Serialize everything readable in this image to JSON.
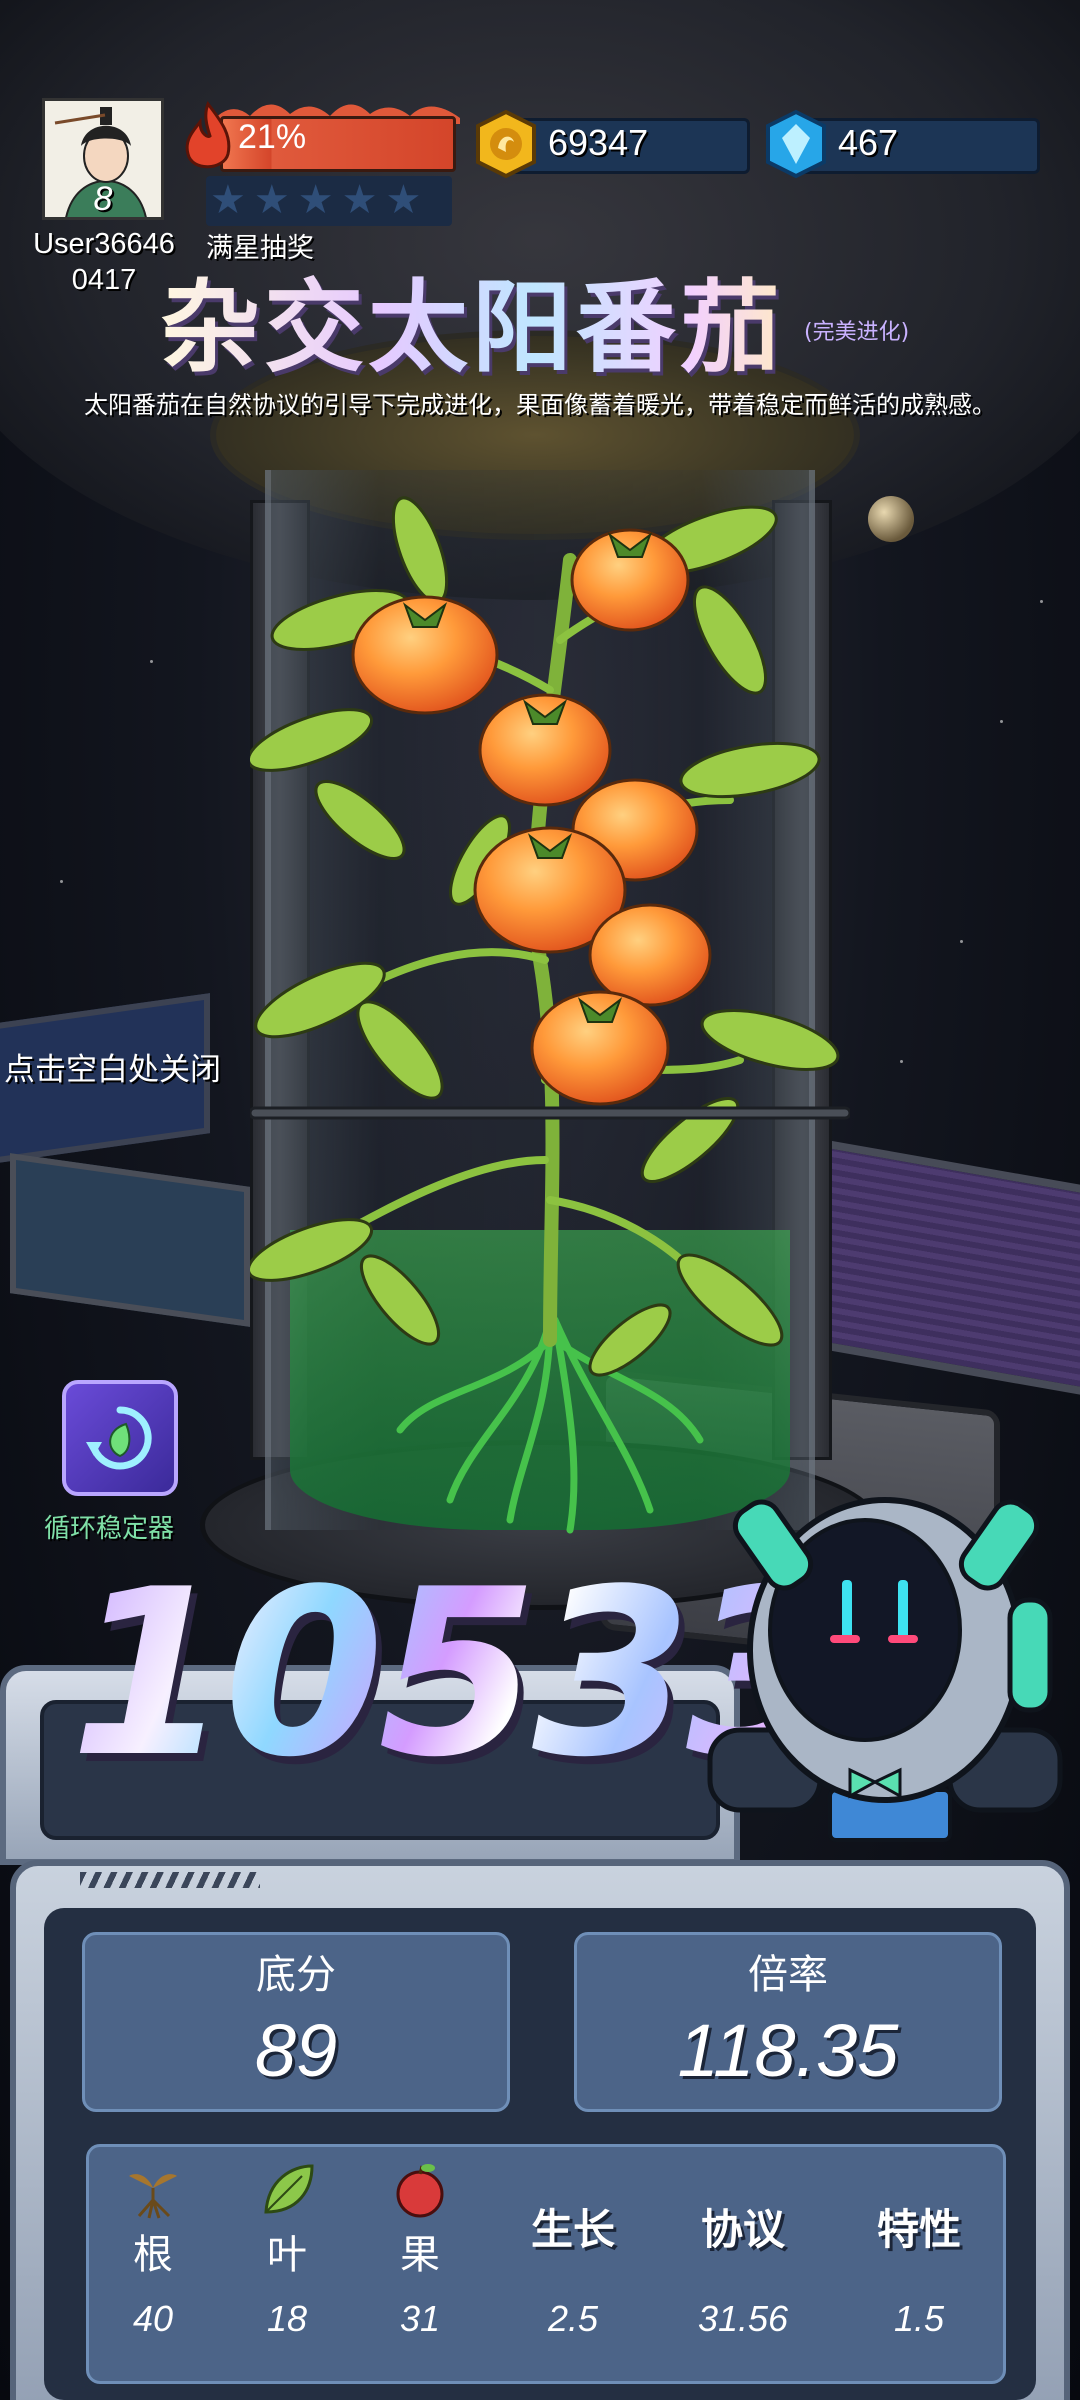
{
  "player": {
    "level": "8",
    "username": "User36646\n0417",
    "heat_percent_label": "21%",
    "heat_progress": 0.21,
    "stars_filled": 0,
    "stars_total": 5,
    "star_reward_label": "满星抽奖",
    "coins": "69347",
    "gems": "467"
  },
  "plant": {
    "name": "杂交太阳番茄",
    "evolution_tag": "(完美进化)",
    "description": "太阳番茄在自然协议的引导下完成进化，果面像蓄着暖光，带着稳定而鲜活的成熟感。"
  },
  "hints": {
    "close": "点击空白处关闭"
  },
  "tool": {
    "name": "循环稳定器",
    "icon": "leaf-cycle-icon"
  },
  "score": {
    "total": "10533",
    "base_label": "底分",
    "base_value": "89",
    "multiplier_label": "倍率",
    "multiplier_value": "118.35"
  },
  "attributes": [
    {
      "key": "root",
      "label": "根",
      "value": "40",
      "icon": "root-sprout-icon"
    },
    {
      "key": "leaf",
      "label": "叶",
      "value": "18",
      "icon": "leaf-icon"
    },
    {
      "key": "fruit",
      "label": "果",
      "value": "31",
      "icon": "apple-icon"
    },
    {
      "key": "growth",
      "label": "生长",
      "value": "2.5"
    },
    {
      "key": "protocol",
      "label": "协议",
      "value": "31.56"
    },
    {
      "key": "trait",
      "label": "特性",
      "value": "1.5"
    }
  ],
  "colors": {
    "heat": "#e0593a",
    "panel": "#4c6488",
    "accent_text": "#c9b2ff",
    "stabilizer_label": "#7fe0a7"
  }
}
